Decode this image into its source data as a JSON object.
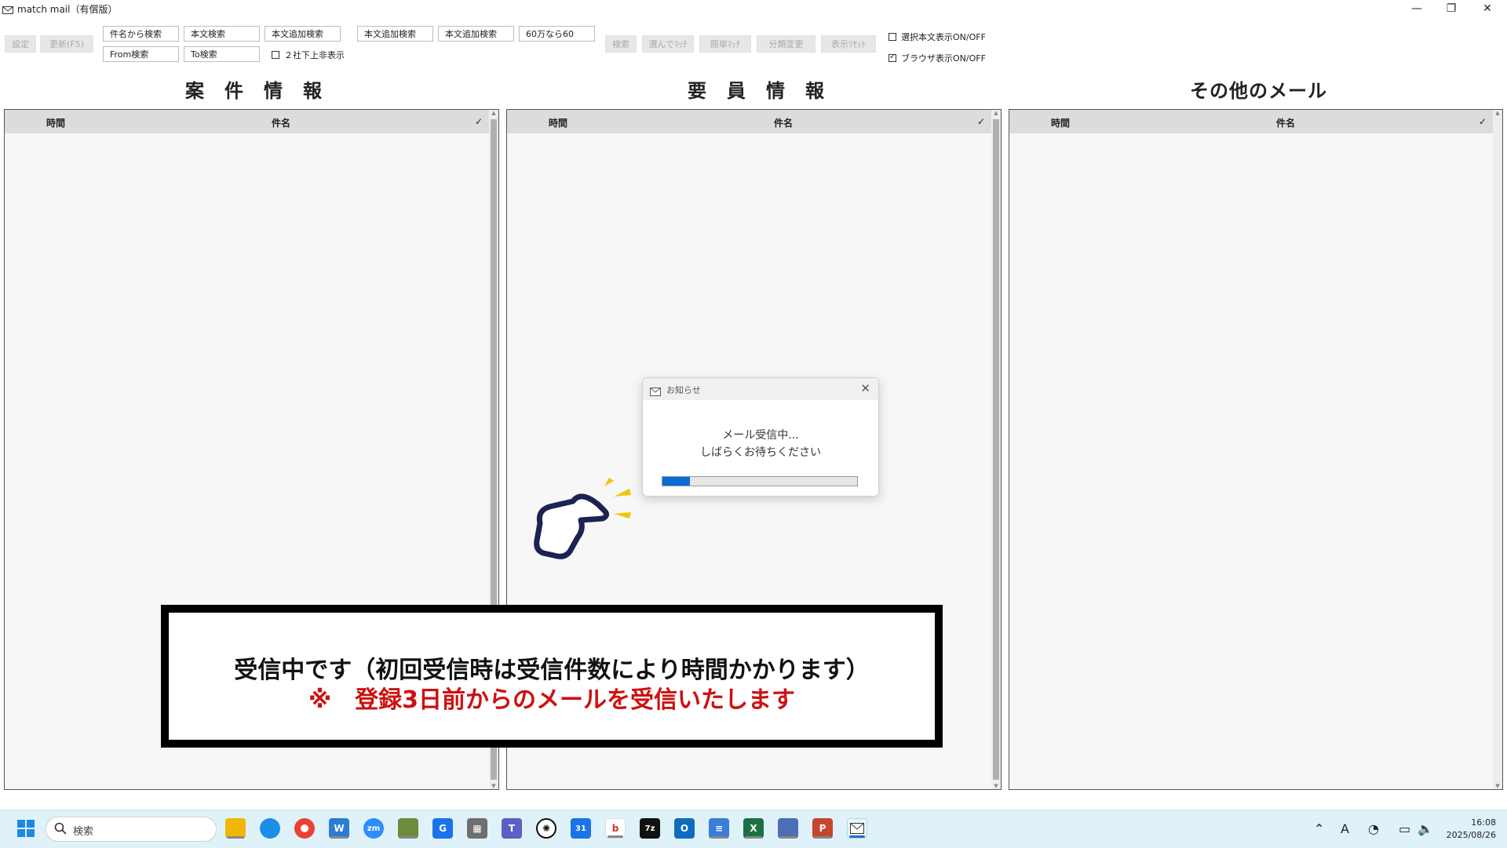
{
  "window": {
    "title": "match mail（有償版）",
    "minimize": "—",
    "maximize": "❐",
    "close": "✕"
  },
  "toolbar": {
    "settings": "設定",
    "refresh": "更新(F5)",
    "subject_search": "件名から検索",
    "body_search": "本文検索",
    "body_add_search_1": "本文追加検索",
    "body_add_search_2": "本文追加検索",
    "body_add_search_3": "本文追加検索",
    "value_field": "60万なら60",
    "from_search": "From検索",
    "to_search": "To検索",
    "hide_two_companies": "２社下上非表示",
    "search": "検索",
    "select_match": "選んでﾏｯﾁ",
    "easy_match": "簡単ﾏｯﾁ",
    "change_category": "分類変更",
    "reset_display": "表示ﾘｾｯﾄ",
    "selected_body_toggle": "選択本文表示ON/OFF",
    "browser_toggle": "ブラウザ表示ON/OFF",
    "selected_body_checked": false,
    "browser_checked": true
  },
  "panels": [
    {
      "title": "案　件　情　報",
      "col_time": "時間",
      "col_subject": "件名",
      "col_check": "✓"
    },
    {
      "title": "要　員　情　報",
      "col_time": "時間",
      "col_subject": "件名",
      "col_check": "✓"
    },
    {
      "title": "その他のメール",
      "col_time": "時間",
      "col_subject": "件名",
      "col_check": "✓"
    }
  ],
  "dialog": {
    "title": "お知らせ",
    "close": "✕",
    "line1": "メール受信中...",
    "line2": "しばらくお待ちください",
    "progress": 0.14
  },
  "annotation": {
    "line1": "受信中です（初回受信時は受信件数により時間かかります）",
    "line2": "※　登録3日前からのメールを受信いたします"
  },
  "taskbar": {
    "search_placeholder": "検索",
    "icons": [
      "windows-start",
      "file-explorer",
      "edge",
      "chrome",
      "word",
      "zoom",
      "app-tool",
      "g-app",
      "calculator",
      "teams",
      "chatgpt",
      "calendar",
      "chat-app",
      "7zip",
      "outlook",
      "notepad",
      "excel",
      "remote-app",
      "powerpoint",
      "match-mail"
    ],
    "ime": "A",
    "time": "16:08",
    "date": "2025/08/26"
  }
}
